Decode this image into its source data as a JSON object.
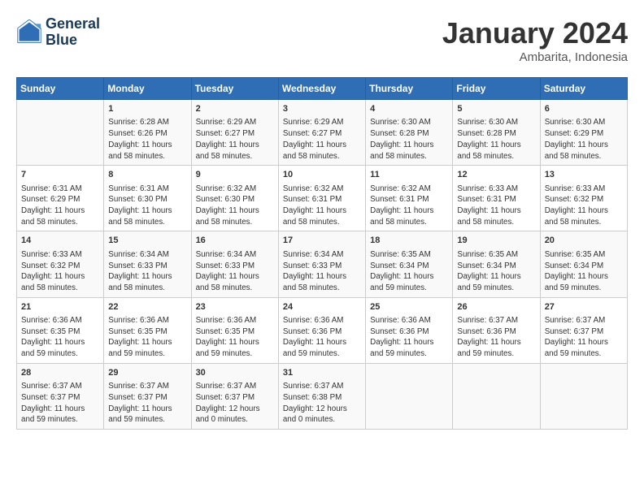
{
  "logo": {
    "line1": "General",
    "line2": "Blue"
  },
  "header": {
    "month": "January 2024",
    "location": "Ambarita, Indonesia"
  },
  "columns": [
    "Sunday",
    "Monday",
    "Tuesday",
    "Wednesday",
    "Thursday",
    "Friday",
    "Saturday"
  ],
  "weeks": [
    [
      {
        "num": "",
        "sunrise": "",
        "sunset": "",
        "daylight": ""
      },
      {
        "num": "1",
        "sunrise": "6:28 AM",
        "sunset": "6:26 PM",
        "daylight": "11 hours and 58 minutes."
      },
      {
        "num": "2",
        "sunrise": "6:29 AM",
        "sunset": "6:27 PM",
        "daylight": "11 hours and 58 minutes."
      },
      {
        "num": "3",
        "sunrise": "6:29 AM",
        "sunset": "6:27 PM",
        "daylight": "11 hours and 58 minutes."
      },
      {
        "num": "4",
        "sunrise": "6:30 AM",
        "sunset": "6:28 PM",
        "daylight": "11 hours and 58 minutes."
      },
      {
        "num": "5",
        "sunrise": "6:30 AM",
        "sunset": "6:28 PM",
        "daylight": "11 hours and 58 minutes."
      },
      {
        "num": "6",
        "sunrise": "6:30 AM",
        "sunset": "6:29 PM",
        "daylight": "11 hours and 58 minutes."
      }
    ],
    [
      {
        "num": "7",
        "sunrise": "6:31 AM",
        "sunset": "6:29 PM",
        "daylight": "11 hours and 58 minutes."
      },
      {
        "num": "8",
        "sunrise": "6:31 AM",
        "sunset": "6:30 PM",
        "daylight": "11 hours and 58 minutes."
      },
      {
        "num": "9",
        "sunrise": "6:32 AM",
        "sunset": "6:30 PM",
        "daylight": "11 hours and 58 minutes."
      },
      {
        "num": "10",
        "sunrise": "6:32 AM",
        "sunset": "6:31 PM",
        "daylight": "11 hours and 58 minutes."
      },
      {
        "num": "11",
        "sunrise": "6:32 AM",
        "sunset": "6:31 PM",
        "daylight": "11 hours and 58 minutes."
      },
      {
        "num": "12",
        "sunrise": "6:33 AM",
        "sunset": "6:31 PM",
        "daylight": "11 hours and 58 minutes."
      },
      {
        "num": "13",
        "sunrise": "6:33 AM",
        "sunset": "6:32 PM",
        "daylight": "11 hours and 58 minutes."
      }
    ],
    [
      {
        "num": "14",
        "sunrise": "6:33 AM",
        "sunset": "6:32 PM",
        "daylight": "11 hours and 58 minutes."
      },
      {
        "num": "15",
        "sunrise": "6:34 AM",
        "sunset": "6:33 PM",
        "daylight": "11 hours and 58 minutes."
      },
      {
        "num": "16",
        "sunrise": "6:34 AM",
        "sunset": "6:33 PM",
        "daylight": "11 hours and 58 minutes."
      },
      {
        "num": "17",
        "sunrise": "6:34 AM",
        "sunset": "6:33 PM",
        "daylight": "11 hours and 58 minutes."
      },
      {
        "num": "18",
        "sunrise": "6:35 AM",
        "sunset": "6:34 PM",
        "daylight": "11 hours and 59 minutes."
      },
      {
        "num": "19",
        "sunrise": "6:35 AM",
        "sunset": "6:34 PM",
        "daylight": "11 hours and 59 minutes."
      },
      {
        "num": "20",
        "sunrise": "6:35 AM",
        "sunset": "6:34 PM",
        "daylight": "11 hours and 59 minutes."
      }
    ],
    [
      {
        "num": "21",
        "sunrise": "6:36 AM",
        "sunset": "6:35 PM",
        "daylight": "11 hours and 59 minutes."
      },
      {
        "num": "22",
        "sunrise": "6:36 AM",
        "sunset": "6:35 PM",
        "daylight": "11 hours and 59 minutes."
      },
      {
        "num": "23",
        "sunrise": "6:36 AM",
        "sunset": "6:35 PM",
        "daylight": "11 hours and 59 minutes."
      },
      {
        "num": "24",
        "sunrise": "6:36 AM",
        "sunset": "6:36 PM",
        "daylight": "11 hours and 59 minutes."
      },
      {
        "num": "25",
        "sunrise": "6:36 AM",
        "sunset": "6:36 PM",
        "daylight": "11 hours and 59 minutes."
      },
      {
        "num": "26",
        "sunrise": "6:37 AM",
        "sunset": "6:36 PM",
        "daylight": "11 hours and 59 minutes."
      },
      {
        "num": "27",
        "sunrise": "6:37 AM",
        "sunset": "6:37 PM",
        "daylight": "11 hours and 59 minutes."
      }
    ],
    [
      {
        "num": "28",
        "sunrise": "6:37 AM",
        "sunset": "6:37 PM",
        "daylight": "11 hours and 59 minutes."
      },
      {
        "num": "29",
        "sunrise": "6:37 AM",
        "sunset": "6:37 PM",
        "daylight": "11 hours and 59 minutes."
      },
      {
        "num": "30",
        "sunrise": "6:37 AM",
        "sunset": "6:37 PM",
        "daylight": "12 hours and 0 minutes."
      },
      {
        "num": "31",
        "sunrise": "6:37 AM",
        "sunset": "6:38 PM",
        "daylight": "12 hours and 0 minutes."
      },
      {
        "num": "",
        "sunrise": "",
        "sunset": "",
        "daylight": ""
      },
      {
        "num": "",
        "sunrise": "",
        "sunset": "",
        "daylight": ""
      },
      {
        "num": "",
        "sunrise": "",
        "sunset": "",
        "daylight": ""
      }
    ]
  ],
  "labels": {
    "sunrise_prefix": "Sunrise: ",
    "sunset_prefix": "Sunset: ",
    "daylight_prefix": "Daylight: "
  }
}
